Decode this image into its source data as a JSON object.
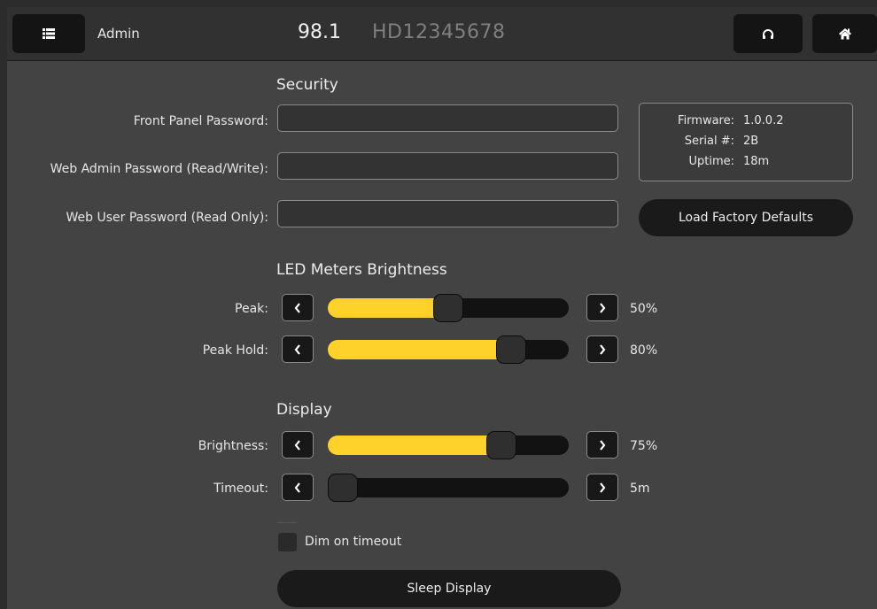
{
  "header": {
    "title": "Admin",
    "frequency": "98.1",
    "station_id": "HD12345678",
    "menu_icon": "list-icon",
    "cast_icon": "headphones-icon",
    "home_icon": "home-icon"
  },
  "security": {
    "title": "Security",
    "fields": [
      {
        "label": "Front Panel Password:",
        "value": "",
        "placeholder": ""
      },
      {
        "label": "Web Admin Password (Read/Write):",
        "value": "",
        "placeholder": ""
      },
      {
        "label": "Web User Password (Read Only):",
        "value": "",
        "placeholder": ""
      }
    ]
  },
  "info": {
    "firmware_label": "Firmware:",
    "firmware_value": "1.0.0.2",
    "serial_label": "Serial #:",
    "serial_value": "2B",
    "uptime_label": "Uptime:",
    "uptime_value": "18m"
  },
  "load_defaults_label": "Load Factory Defaults",
  "led_meters": {
    "title": "LED Meters Brightness",
    "sliders": [
      {
        "label": "Peak:",
        "value_text": "50%",
        "level": 0.5
      },
      {
        "label": "Peak Hold:",
        "value_text": "80%",
        "level": 0.8
      }
    ]
  },
  "display": {
    "title": "Display",
    "sliders": [
      {
        "label": "Brightness:",
        "value_text": "75%",
        "level": 0.75
      },
      {
        "label": "Timeout:",
        "value_text": "5m",
        "level": 0.0
      }
    ],
    "dim_label": "Dim on timeout",
    "dim_checked": false,
    "sleep_label": "Sleep Display"
  },
  "colors": {
    "accent": "#ffd22b",
    "background": "#434343",
    "header": "#313131",
    "button": "#1a1a1a"
  }
}
